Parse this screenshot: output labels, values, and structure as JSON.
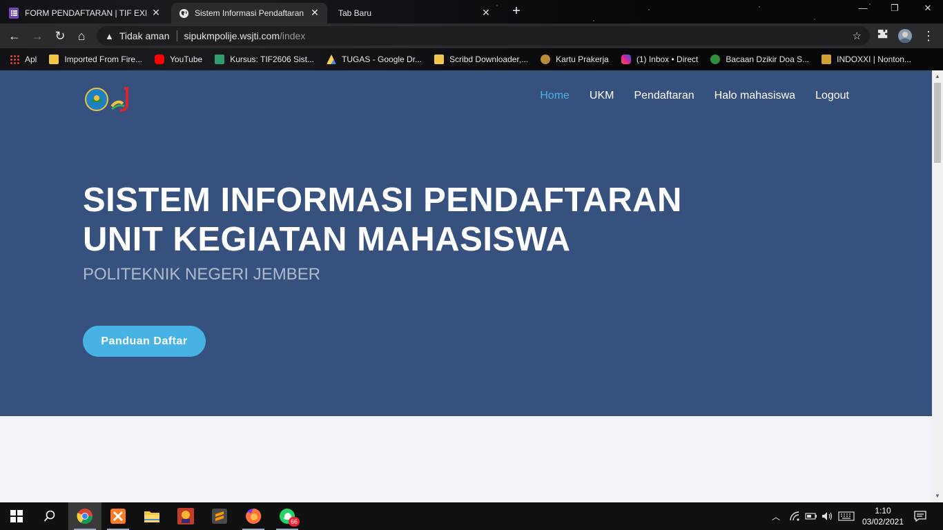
{
  "browser": {
    "tabs": [
      {
        "title": "FORM PENDAFTARAN | TIF EXHIE",
        "active": false,
        "icon": "google-forms-icon"
      },
      {
        "title": "Sistem Informasi Pendaftaran Un",
        "active": true,
        "icon": "globe-icon"
      },
      {
        "title": "Tab Baru",
        "active": false,
        "icon": ""
      }
    ],
    "address": {
      "security_label": "Tidak aman",
      "host": "sipukmpolije.wsjti.com",
      "path": "/index"
    },
    "bookmarks": [
      {
        "label": "Apl",
        "color": "#ff6b3d"
      },
      {
        "label": "Imported From Fire...",
        "color": "#f4c542"
      },
      {
        "label": "YouTube",
        "color": "#ff0000"
      },
      {
        "label": "Kursus: TIF2606 Sist...",
        "color": "#2f9e6e"
      },
      {
        "label": "TUGAS - Google Dr...",
        "color": "#1fa463"
      },
      {
        "label": "Scribd Downloader,...",
        "color": "#f2c64a"
      },
      {
        "label": "Kartu Prakerja",
        "color": "#b98b38"
      },
      {
        "label": "(1) Inbox • Direct",
        "color": "#d6249f"
      },
      {
        "label": "Bacaan Dzikir Doa S...",
        "color": "#2f8f3a"
      },
      {
        "label": "INDOXXI | Nonton...",
        "color": "#d2a035"
      }
    ]
  },
  "site": {
    "nav": [
      {
        "label": "Home",
        "active": true
      },
      {
        "label": "UKM",
        "active": false
      },
      {
        "label": "Pendaftaran",
        "active": false
      },
      {
        "label": "Halo mahasiswa",
        "active": false
      },
      {
        "label": "Logout",
        "active": false
      }
    ],
    "hero": {
      "title_line1": "SISTEM INFORMASI PENDAFTARAN",
      "title_line2": "UNIT KEGIATAN MAHASISWA",
      "subtitle": "POLITEKNIK NEGERI JEMBER",
      "cta_label": "Panduan Daftar"
    },
    "colors": {
      "hero_bg": "#37517e",
      "accent": "#47b2e4"
    }
  },
  "taskbar": {
    "apps": [
      "windows-start-icon",
      "search-icon",
      "chrome-icon",
      "xampp-icon",
      "file-explorer-icon",
      "game-icon",
      "sublime-text-icon",
      "firefox-icon",
      "whatsapp-icon"
    ],
    "whatsapp_badge": "66",
    "time": "1:10",
    "date": "03/02/2021"
  }
}
